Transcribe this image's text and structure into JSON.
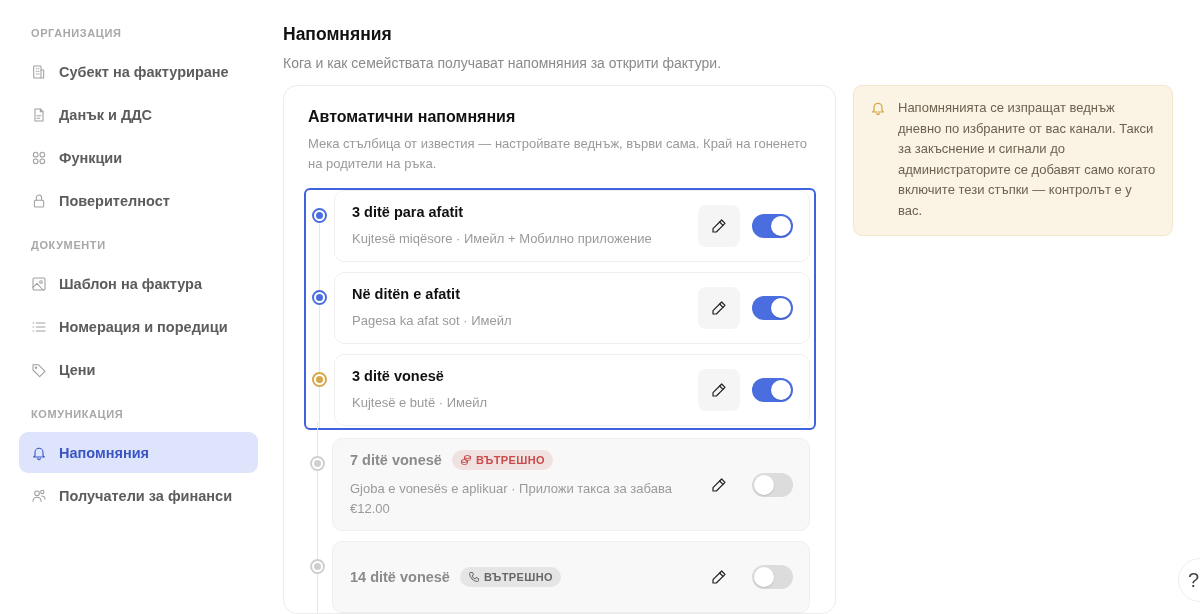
{
  "sidebar": {
    "sections": [
      {
        "heading": "ОРГАНИЗАЦИЯ",
        "items": [
          {
            "label": "Субект на фактуриране",
            "kind": "building",
            "selected": false
          },
          {
            "label": "Данък и ДДС",
            "kind": "document",
            "selected": false
          },
          {
            "label": "Функции",
            "kind": "grid",
            "selected": false
          },
          {
            "label": "Поверителност",
            "kind": "lock",
            "selected": false
          }
        ]
      },
      {
        "heading": "ДОКУМЕНТИ",
        "items": [
          {
            "label": "Шаблон на фактура",
            "kind": "image",
            "selected": false
          },
          {
            "label": "Номерация и поредици",
            "kind": "list",
            "selected": false
          },
          {
            "label": "Цени",
            "kind": "tag",
            "selected": false
          }
        ]
      },
      {
        "heading": "КОМУНИКАЦИЯ",
        "items": [
          {
            "label": "Напомняния",
            "kind": "bell",
            "selected": true
          },
          {
            "label": "Получатели за финанси",
            "kind": "users",
            "selected": false
          }
        ]
      }
    ]
  },
  "page": {
    "title": "Напомняния",
    "subtitle": "Кога и как семействата получават напомняния за открити фактури."
  },
  "card": {
    "title": "Автоматични напомняния",
    "description": "Мека стълбица от известия — настройвате веднъж, върви сама. Край на гоненето на родители на ръка.",
    "steps": [
      {
        "title": "3 ditë para afatit",
        "description": "Kujtesë miqësore · Имейл + Мобилно приложение",
        "on": true,
        "highlighted": true,
        "color": "#4a6ee0"
      },
      {
        "title": "Në ditën e afatit",
        "description": "Pagesa ka afat sot · Имейл",
        "on": true,
        "highlighted": true,
        "color": "#4a6ee0"
      },
      {
        "title": "3 ditë vonesë",
        "description": "Kujtesë e butë · Имейл",
        "on": true,
        "highlighted": true,
        "color": "#d9a64a"
      },
      {
        "title": "7 ditë vonesë",
        "badge": {
          "label": "ВЪТРЕШНО",
          "kind": "coins",
          "color": "#c94a4a"
        },
        "description": "Gjoba e vonesës e aplikuar · Приложи такса за забава €12.00",
        "on": false,
        "highlighted": false,
        "color": "#cfcfcf"
      },
      {
        "title": "14 ditë vonesë",
        "badge": {
          "label": "ВЪТРЕШНО",
          "kind": "phone",
          "color": "#666666"
        },
        "on": false,
        "highlighted": false,
        "color": "#cfcfcf"
      }
    ]
  },
  "info": {
    "text": "Напомнянията се изпращат веднъж дневно по избраните от вас канали. Такси за закъснение и сигнали до администраторите се добавят само когато включите тези стъпки — контролът е у вас."
  },
  "help": {
    "label": "?"
  }
}
